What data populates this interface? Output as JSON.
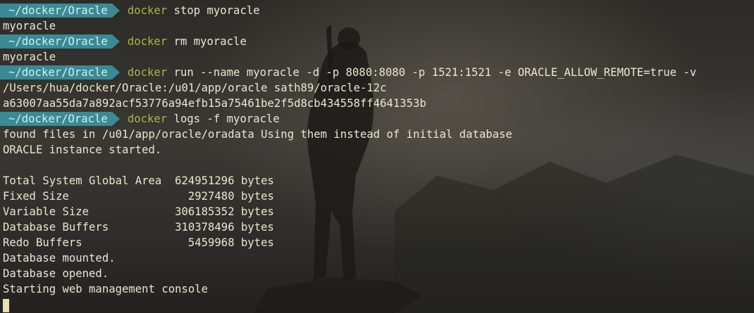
{
  "prompt_path": "~/docker/Oracle",
  "lines": [
    {
      "type": "prompt",
      "cmd": "docker",
      "args": "stop myoracle"
    },
    {
      "type": "output",
      "text": "myoracle"
    },
    {
      "type": "prompt",
      "cmd": "docker",
      "args": "rm myoracle"
    },
    {
      "type": "output",
      "text": "myoracle"
    },
    {
      "type": "prompt",
      "cmd": "docker",
      "args": "run --name myoracle -d -p 8080:8080 -p 1521:1521 -e ORACLE_ALLOW_REMOTE=true -v"
    },
    {
      "type": "output",
      "text": "/Users/hua/docker/Oracle:/u01/app/oracle sath89/oracle-12c"
    },
    {
      "type": "output",
      "text": "a63007aa55da7a892acf53776a94efb15a75461be2f5d8cb434558ff4641353b"
    },
    {
      "type": "prompt",
      "cmd": "docker",
      "args": "logs -f myoracle"
    },
    {
      "type": "output",
      "text": "found files in /u01/app/oracle/oradata Using them instead of initial database"
    },
    {
      "type": "output",
      "text": "ORACLE instance started."
    },
    {
      "type": "output",
      "text": ""
    },
    {
      "type": "output",
      "text": "Total System Global Area  624951296 bytes"
    },
    {
      "type": "output",
      "text": "Fixed Size                  2927480 bytes"
    },
    {
      "type": "output",
      "text": "Variable Size             306185352 bytes"
    },
    {
      "type": "output",
      "text": "Database Buffers          310378496 bytes"
    },
    {
      "type": "output",
      "text": "Redo Buffers                5459968 bytes"
    },
    {
      "type": "output",
      "text": "Database mounted."
    },
    {
      "type": "output",
      "text": "Database opened."
    },
    {
      "type": "output",
      "text": "Starting web management console"
    },
    {
      "type": "cursor"
    }
  ],
  "colors": {
    "prompt_bg": "#3a8a93",
    "prompt_fg": "#d4eef1",
    "command": "#a7b64a",
    "text": "#ece6cf",
    "cursor": "#e8dfb2"
  }
}
